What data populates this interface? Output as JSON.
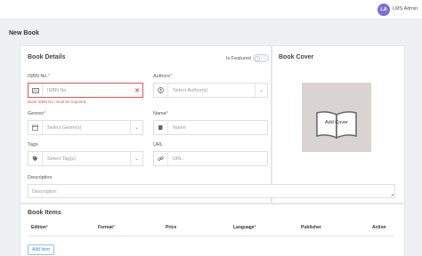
{
  "header": {
    "avatar_initials": "LA",
    "user_name": "LMS Admin"
  },
  "page": {
    "title": "New Book"
  },
  "book_details": {
    "title": "Book Details",
    "featured_label": "Is Featured",
    "isbn": {
      "label": "ISBN No.",
      "required": "*",
      "placeholder": "ISBN No.",
      "error": "Book ISBN No. must be required."
    },
    "authors": {
      "label": "Authors",
      "required": "*",
      "placeholder": "Select Author(s)"
    },
    "genres": {
      "label": "Genres",
      "required": "*",
      "placeholder": "Select Genre(s)"
    },
    "name": {
      "label": "Name",
      "required": "*",
      "placeholder": "Name"
    },
    "tags": {
      "label": "Tags",
      "placeholder": "Select Tag(s)"
    },
    "url": {
      "label": "URL",
      "placeholder": "URL"
    },
    "description": {
      "label": "Description",
      "placeholder": "Description"
    }
  },
  "book_cover": {
    "title": "Book Cover",
    "add_label": "Add Cover"
  },
  "book_items": {
    "title": "Book Items",
    "columns": [
      {
        "label": "Edition",
        "required": "*"
      },
      {
        "label": "Format",
        "required": "*"
      },
      {
        "label": "Price",
        "required": ""
      },
      {
        "label": "Language",
        "required": "*"
      },
      {
        "label": "Publisher",
        "required": ""
      },
      {
        "label": "Action",
        "required": ""
      }
    ],
    "add_button": "Add Item"
  },
  "colors": {
    "accent": "#3a8fd1",
    "error": "#e05555",
    "avatar": "#7b6fd6"
  }
}
